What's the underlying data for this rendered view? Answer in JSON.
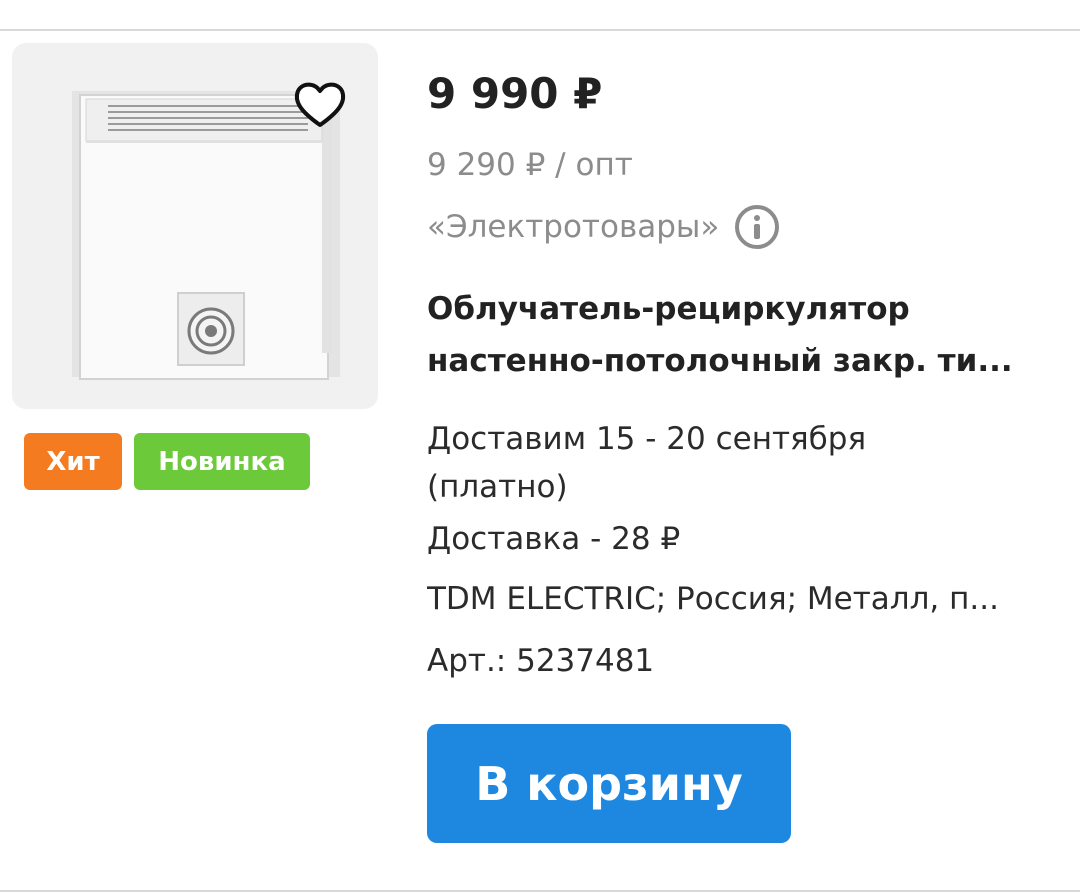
{
  "product": {
    "price": "9 990 ₽",
    "wholesale_price": "9 290 ₽ / опт",
    "seller": "«Электротовары»",
    "title_line1": "Облучатель-рециркулятор",
    "title_line2": "настенно-потолочный  закр. ти...",
    "delivery_line1": "Доставим 15 - 20 сентября",
    "delivery_line2": "(платно)",
    "delivery_cost": "Доставка - 28 ₽",
    "specs": "TDM ELECTRIC; Россия; Металл, п...",
    "article": "Арт.: 5237481"
  },
  "badges": {
    "hit": "Хит",
    "new": "Новинка"
  },
  "actions": {
    "add_to_cart": "В корзину"
  },
  "icons": {
    "favorite": "heart-outline-icon",
    "info": "info-circle-icon"
  },
  "colors": {
    "badge_hit": "#f47b20",
    "badge_new": "#6bc93a",
    "cart_button": "#1e88e0",
    "muted_text": "#8c8c8c"
  }
}
